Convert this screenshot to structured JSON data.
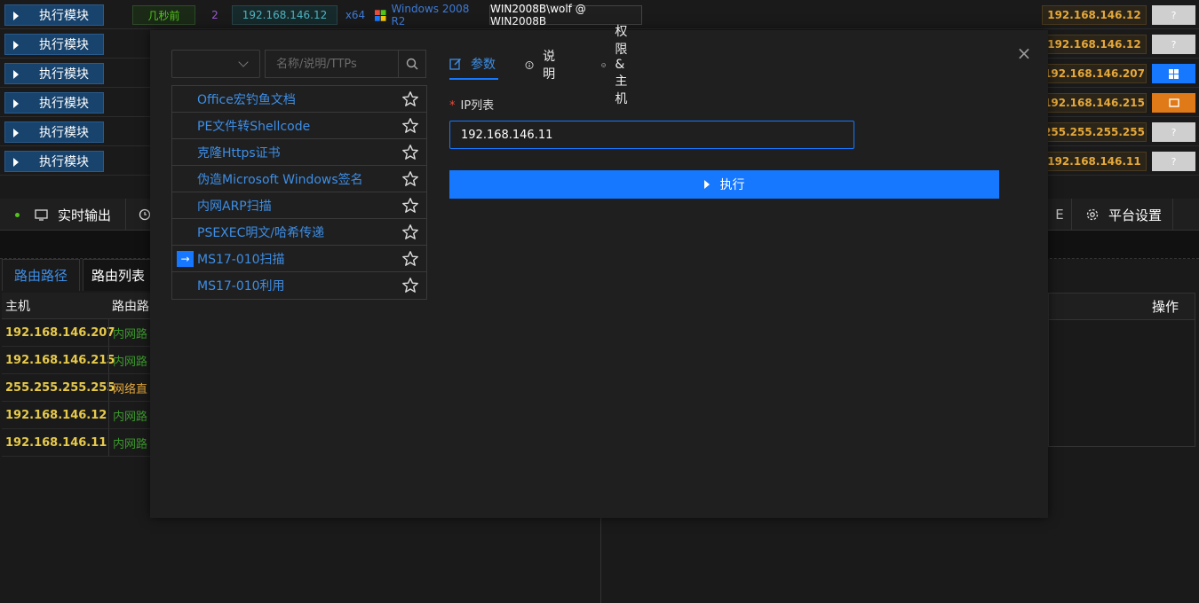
{
  "top_rows": {
    "exec_label": "执行模块",
    "row0": {
      "time": "几秒前",
      "pid": "2",
      "ip": "192.168.146.12",
      "arch": "x64",
      "os": "Windows 2008 R2",
      "user": "WIN2008B\\wolf @ WIN2008B"
    },
    "right": [
      {
        "ip": "192.168.146.12",
        "os": "?",
        "os_color": "#cfcfcf"
      },
      {
        "ip": "192.168.146.12",
        "os": "?",
        "os_color": "#cfcfcf"
      },
      {
        "ip": "192.168.146.207",
        "os": "win-icon",
        "os_color": "#1677ff"
      },
      {
        "ip": "192.168.146.215",
        "os": "box-icon",
        "os_color": "#e07a19"
      },
      {
        "ip": "255.255.255.255",
        "os": "?",
        "os_color": "#cfcfcf"
      },
      {
        "ip": "192.168.146.11",
        "os": "?",
        "os_color": "#cfcfcf"
      }
    ]
  },
  "bottom_tabs": {
    "realtime": "实时输出",
    "partial_e": "E",
    "settings": "平台设置"
  },
  "route_tabs": [
    "路由路径",
    "路由列表"
  ],
  "route_table": {
    "headers": [
      "主机",
      "路由路"
    ],
    "rows": [
      {
        "host": "192.168.146.207",
        "route": "内网路",
        "color": "#3c9a2d"
      },
      {
        "host": "192.168.146.215",
        "route": "内网路",
        "color": "#3c9a2d"
      },
      {
        "host": "255.255.255.255",
        "route": "网络直",
        "color": "#e5a83a"
      },
      {
        "host": "192.168.146.12",
        "route": "内网路",
        "color": "#3c9a2d"
      },
      {
        "host": "192.168.146.11",
        "route": "内网路",
        "color": "#3c9a2d"
      }
    ]
  },
  "right_panel": {
    "header": "操作"
  },
  "modal": {
    "search_placeholder": "名称/说明/TTPs",
    "modules": [
      "Office宏钓鱼文档",
      "PE文件转Shellcode",
      "克隆Https证书",
      "伪造Microsoft Windows签名",
      "内网ARP扫描",
      "PSEXEC明文/哈希传递",
      "MS17-010扫描",
      "MS17-010利用"
    ],
    "selected_index": 6,
    "tabs": [
      "参数",
      "说明",
      "权限&主机"
    ],
    "field_label": "IP列表",
    "ip_value": "192.168.146.11",
    "run_label": "执行",
    "close": "×"
  },
  "colors": {
    "accent": "#1677ff",
    "link": "#3d8ee6"
  }
}
